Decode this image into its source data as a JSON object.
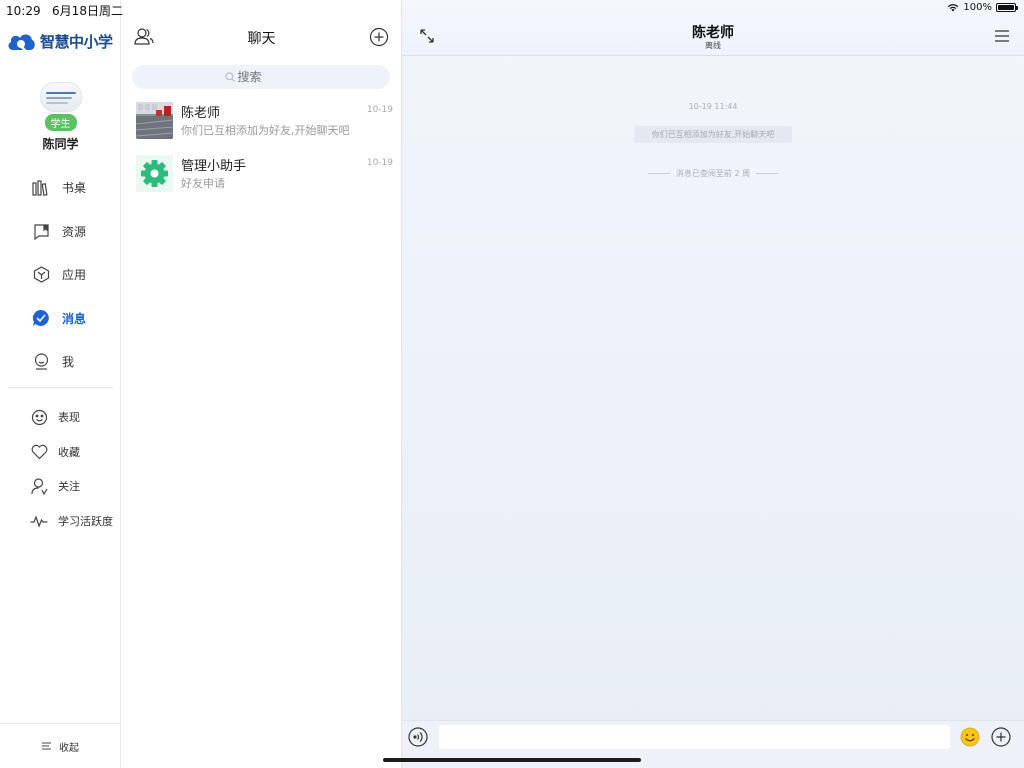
{
  "status_bar": {
    "time": "10:29",
    "date": "6月18日周二",
    "battery": "100%"
  },
  "app": {
    "name": "智慧中小学"
  },
  "profile": {
    "role": "学生",
    "name": "陈同学"
  },
  "nav": {
    "items": [
      {
        "label": "书桌",
        "icon": "bookshelf-icon"
      },
      {
        "label": "资源",
        "icon": "bookmark-icon"
      },
      {
        "label": "应用",
        "icon": "cube-icon"
      },
      {
        "label": "消息",
        "icon": "message-icon",
        "active": true
      },
      {
        "label": "我",
        "icon": "person-icon"
      }
    ],
    "secondary": [
      {
        "label": "表现",
        "icon": "smile-icon"
      },
      {
        "label": "收藏",
        "icon": "heart-icon"
      },
      {
        "label": "关注",
        "icon": "follow-icon"
      },
      {
        "label": "学习活跃度",
        "icon": "pulse-icon"
      }
    ],
    "collapse_label": "收起"
  },
  "chat_list": {
    "title": "聊天",
    "search_placeholder": "搜索",
    "conversations": [
      {
        "name": "陈老师",
        "preview": "你们已互相添加为好友,开始聊天吧",
        "time": "10-19"
      },
      {
        "name": "管理小助手",
        "preview": "好友申请",
        "time": "10-19"
      }
    ]
  },
  "chat": {
    "title": "陈老师",
    "subtitle": "离线",
    "timestamp": "10-19  11:44",
    "system_message": "你们已互相添加为好友,开始聊天吧",
    "read_note": "消息已查阅至前 2 周"
  },
  "colors": {
    "accent": "#1e63d6",
    "badge": "#5bc263",
    "helper_icon": "#2dbb7b"
  }
}
